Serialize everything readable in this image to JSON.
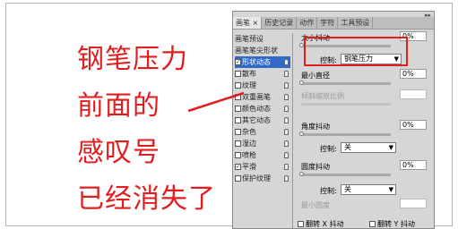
{
  "annotation": {
    "line1": "钢笔压力",
    "line2": "前面的",
    "line3": "感叹号",
    "line4": "已经消失了"
  },
  "panel": {
    "tabs": [
      "画笔 ×",
      "历史记录",
      "动作",
      "字符",
      "工具预设"
    ],
    "left_items": [
      {
        "label": "画笔预设",
        "checked": null
      },
      {
        "label": "画笔笔尖形状",
        "checked": null
      },
      {
        "label": "形状动态",
        "checked": true,
        "selected": true
      },
      {
        "label": "散布",
        "checked": false
      },
      {
        "label": "纹理",
        "checked": false
      },
      {
        "label": "双重画笔",
        "checked": false
      },
      {
        "label": "颜色动态",
        "checked": false
      },
      {
        "label": "其它动态",
        "checked": false
      },
      {
        "label": "杂色",
        "checked": false
      },
      {
        "label": "湿边",
        "checked": false
      },
      {
        "label": "喷枪",
        "checked": false
      },
      {
        "label": "平滑",
        "checked": true
      },
      {
        "label": "保护纹理",
        "checked": false
      }
    ],
    "right": {
      "size_jitter_label": "大小抖动",
      "size_jitter_value": "0%",
      "control1_label": "控制:",
      "control1_value": "钢笔压力",
      "min_diameter_label": "最小直径",
      "min_diameter_value": "0%",
      "tilt_scale_label": "倾斜缩放比例",
      "angle_jitter_label": "角度抖动",
      "angle_jitter_value": "0%",
      "control2_label": "控制:",
      "control2_value": "关",
      "roundness_jitter_label": "圆度抖动",
      "roundness_jitter_value": "0%",
      "control3_label": "控制:",
      "control3_value": "关",
      "min_roundness_label": "最小圆度",
      "flip_x_label": "翻转 X 抖动",
      "flip_y_label": "翻转 Y 抖动"
    }
  },
  "colors": {
    "annotation": "#e21d1d",
    "selection": "#3169c6"
  }
}
